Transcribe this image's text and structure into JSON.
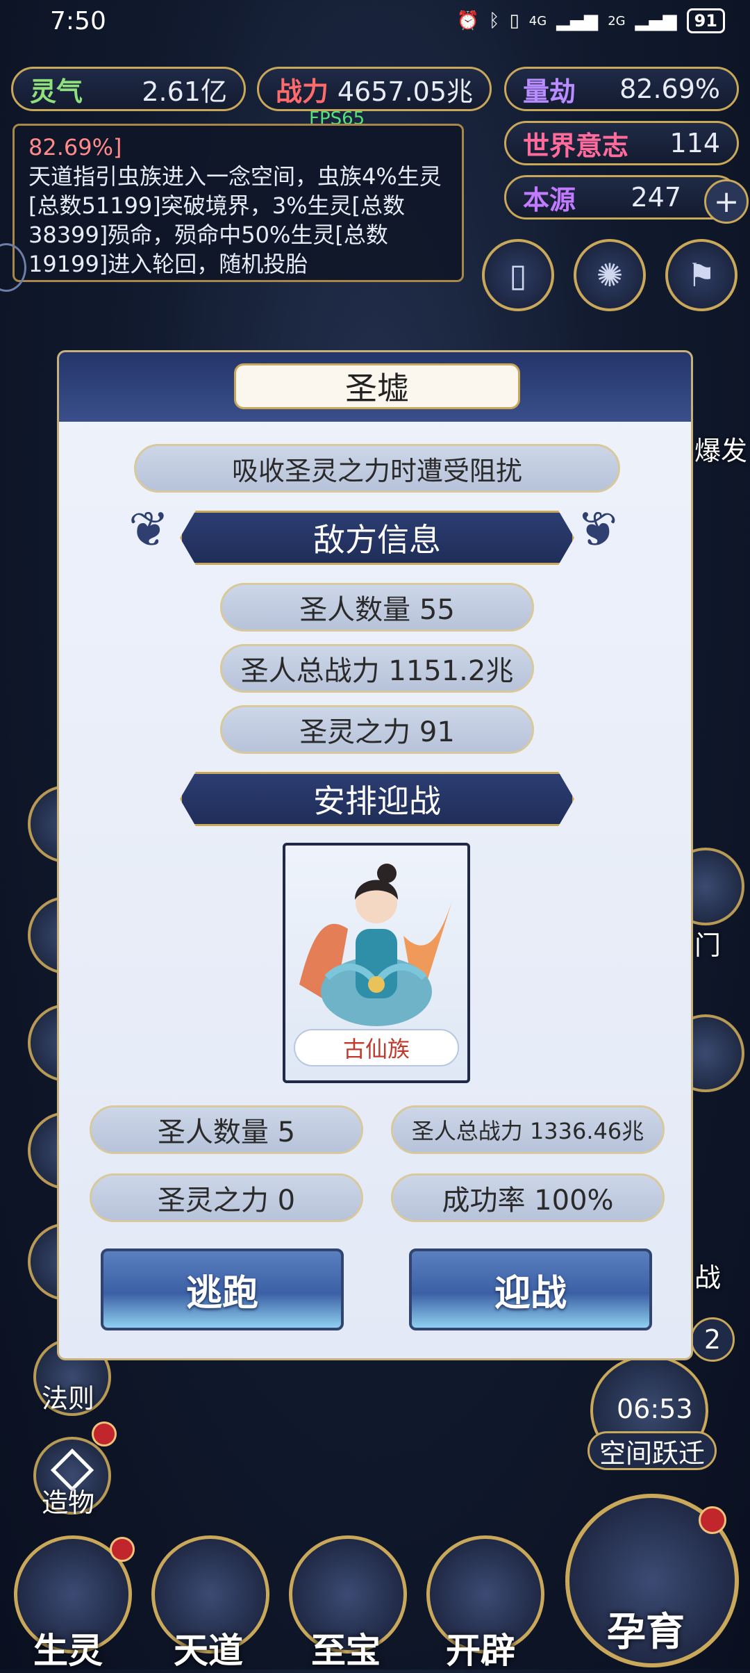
{
  "status_bar": {
    "time": "7:50",
    "battery": "91",
    "net1": "4G",
    "net2": "2G"
  },
  "stats": {
    "lingqi": {
      "label": "灵气",
      "value": "2.61亿"
    },
    "zhanli": {
      "label": "战力",
      "value": "4657.05兆"
    },
    "liangjie": {
      "label": "量劫",
      "value": "82.69%"
    },
    "shijie": {
      "label": "世界意志",
      "value": "114"
    },
    "benyuan": {
      "label": "本源",
      "value": "247"
    }
  },
  "fps": "FPS65",
  "log": {
    "percent": "82.69%]",
    "text": "天道指引虫族进入一念空间，虫族4%生灵[总数51199]突破境界，3%生灵[总数38399]殒命，殒命中50%生灵[总数19199]进入轮回，随机投胎"
  },
  "side_fragments": {
    "baofa": "爆发",
    "men": "门",
    "zhan": "战",
    "count": "2"
  },
  "side_menu": {
    "faze": "法则",
    "zaowu": "造物"
  },
  "space_jump": {
    "timer": "06:53",
    "label": "空间跃迁"
  },
  "bottom_nav": {
    "shengling": "生灵",
    "tiandao": "天道",
    "zhibao": "至宝",
    "kaipi": "开辟",
    "yunyu": "孕育"
  },
  "modal": {
    "title": "圣墟",
    "event": "吸收圣灵之力时遭受阻扰",
    "enemy_header": "敌方信息",
    "enemy": {
      "count": "圣人数量 55",
      "power": "圣人总战力 1151.2兆",
      "force": "圣灵之力 91"
    },
    "arrange_header": "安排迎战",
    "card_name": "古仙族",
    "ally": {
      "count": "圣人数量 5",
      "power": "圣人总战力 1336.46兆",
      "force": "圣灵之力 0",
      "rate": "成功率 100%"
    },
    "flee": "逃跑",
    "fight": "迎战"
  },
  "colors": {
    "gold": "#c9a85a",
    "navy": "#24356a",
    "panel": "#e8edf8",
    "green_fps": "#55e07a"
  }
}
